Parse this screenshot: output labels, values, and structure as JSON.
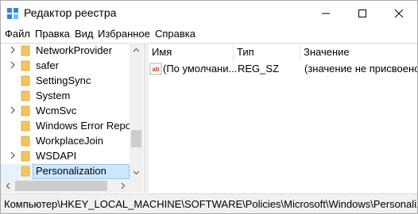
{
  "window": {
    "title": "Редактор реестра"
  },
  "menu": [
    "Файл",
    "Правка",
    "Вид",
    "Избранное",
    "Справка"
  ],
  "tree": {
    "items": [
      {
        "label": "NetworkProvider",
        "expandable": true
      },
      {
        "label": "safer",
        "expandable": true
      },
      {
        "label": "SettingSync",
        "expandable": false
      },
      {
        "label": "System",
        "expandable": false
      },
      {
        "label": "WcmSvc",
        "expandable": true
      },
      {
        "label": "Windows Error Report",
        "expandable": false
      },
      {
        "label": "WorkplaceJoin",
        "expandable": false
      },
      {
        "label": "WSDAPI",
        "expandable": true
      },
      {
        "label": "Personalization",
        "expandable": false,
        "selected": true
      }
    ]
  },
  "values": {
    "columns": [
      "Имя",
      "Тип",
      "Значение"
    ],
    "rows": [
      {
        "name": "(По умолчани...",
        "type": "REG_SZ",
        "data": "(значение не присвоено)"
      }
    ]
  },
  "status": {
    "path": "Компьютер\\HKEY_LOCAL_MACHINE\\SOFTWARE\\Policies\\Microsoft\\Windows\\Personalization"
  },
  "colors": {
    "folder": "#f3c560",
    "selection": "#cce8ff",
    "reg_icon": "#c0392b"
  }
}
